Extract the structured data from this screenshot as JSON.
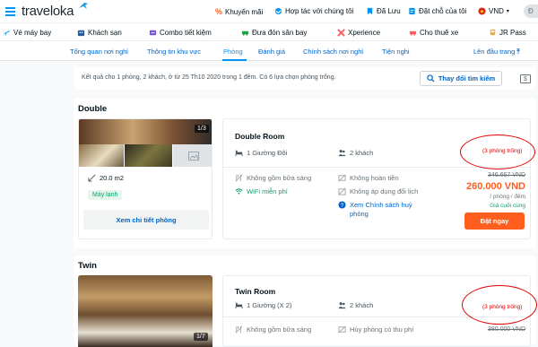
{
  "header": {
    "logo": "traveloka",
    "links": [
      {
        "label": "Khuyến mãi",
        "icon": "percent-icon"
      },
      {
        "label": "Hợp tác với chúng tôi",
        "icon": "handshake-icon"
      },
      {
        "label": "Đã Lưu",
        "icon": "bookmark-icon"
      },
      {
        "label": "Đặt chỗ của tôi",
        "icon": "receipt-icon"
      }
    ],
    "currency": "VND",
    "user_initial": "Đ"
  },
  "nav": [
    {
      "label": "Vé máy bay",
      "icon": "plane-icon"
    },
    {
      "label": "Khách sạn",
      "icon": "hotel-icon"
    },
    {
      "label": "Combo tiết kiệm",
      "icon": "combo-icon"
    },
    {
      "label": "Đưa đón sân bay",
      "icon": "car-icon"
    },
    {
      "label": "Xperience",
      "icon": "xperience-icon"
    },
    {
      "label": "Cho thuê xe",
      "icon": "car-rental-icon"
    },
    {
      "label": "JR Pass",
      "icon": "train-icon"
    }
  ],
  "tabs": [
    {
      "label": "Tổng quan nơi nghỉ"
    },
    {
      "label": "Thông tin khu vực"
    },
    {
      "label": "Phòng"
    },
    {
      "label": "Đánh giá"
    },
    {
      "label": "Chính sách nơi nghỉ"
    },
    {
      "label": "Tiện nghi"
    }
  ],
  "back_to_top": "Lên đầu trang",
  "summary": {
    "text": "Kết quả cho 1 phòng, 2 khách, ở từ 25 Th10 2020 trong 1 đêm. Có 6 lựa chọn phòng trống.",
    "change_label": "Thay đổi tìm kiếm"
  },
  "rooms": [
    {
      "section": "Double",
      "photo_counter": "1/3",
      "area": "20.0 m2",
      "amenity": "Máy lạnh",
      "details_button": "Xem chi tiết phòng",
      "name": "Double Room",
      "bed": "1 Giường Đôi",
      "guests": "2 khách",
      "availability": "(3 phòng trống)",
      "features": [
        "Không gồm bữa sáng",
        "WiFi miễn phí"
      ],
      "policies": [
        "Không hoàn tiền",
        "Không áp dụng đổi lịch",
        "Xem Chính sách huỷ phòng"
      ],
      "old_price": "346.667 VND",
      "price": "260.000 VND",
      "price_unit": "/ phòng / đêm",
      "price_note": "Giá cuối cùng",
      "book_label": "Đặt ngay"
    },
    {
      "section": "Twin",
      "photo_counter": "1/7",
      "name": "Twin Room",
      "bed": "1 Giường (X 2)",
      "guests": "2 khách",
      "availability": "(3 phòng trống)",
      "features": [
        "Không gồm bữa sáng"
      ],
      "policies": [
        "Hủy phòng có thu phí"
      ],
      "old_price": "380.000 VND"
    }
  ],
  "colors": {
    "brand": "#0194f3",
    "link": "#0264c8",
    "price": "#ff5e1f",
    "book": "#ff5e1f",
    "green": "#05a569",
    "annotation": "#e10000"
  }
}
